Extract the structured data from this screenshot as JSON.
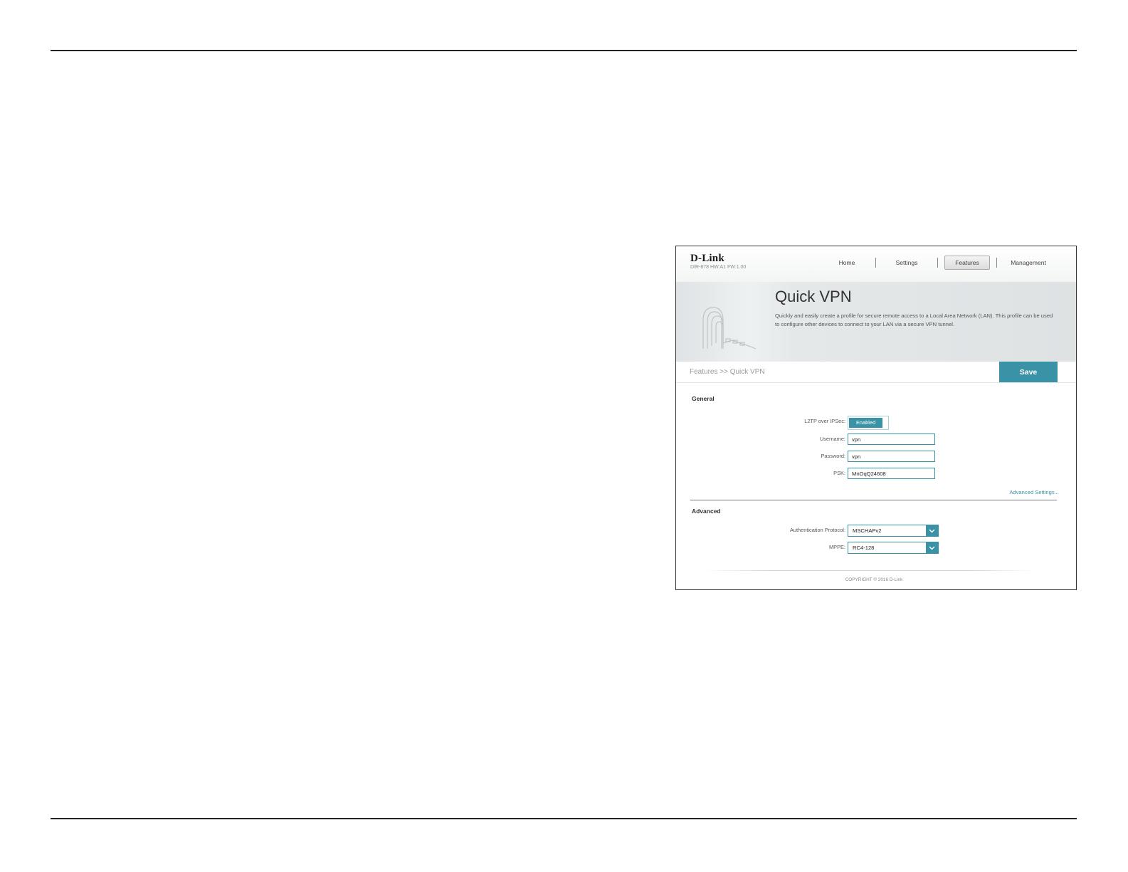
{
  "router_ui": {
    "brand": "D-Link",
    "model_info": "DIR-878 HW:A1 FW:1.00",
    "nav": {
      "home": "Home",
      "settings": "Settings",
      "features": "Features",
      "management": "Management"
    },
    "page_title": "Quick VPN",
    "page_description": "Quickly and easily create a profile for secure remote access to a Local Area Network (LAN). This profile can be used to configure other devices to connect to your LAN via a secure VPN tunnel.",
    "breadcrumb": "Features >> Quick VPN",
    "save_label": "Save",
    "general": {
      "title": "General",
      "l2tp_label": "L2TP over IPSec:",
      "l2tp_value": "Enabled",
      "username_label": "Username:",
      "username_value": "vpn",
      "password_label": "Password:",
      "password_value": "vpn",
      "psk_label": "PSK:",
      "psk_value": "MnOqQ24608"
    },
    "advanced_link": "Advanced Settings...",
    "advanced": {
      "title": "Advanced",
      "auth_label": "Authentication Protocol:",
      "auth_value": "MSCHAPv2",
      "mppe_label": "MPPE:",
      "mppe_value": "RC4-128"
    },
    "copyright": "COPYRIGHT © 2016 D-Link"
  },
  "colors": {
    "accent": "#3a92a6",
    "rule": "#222222"
  }
}
